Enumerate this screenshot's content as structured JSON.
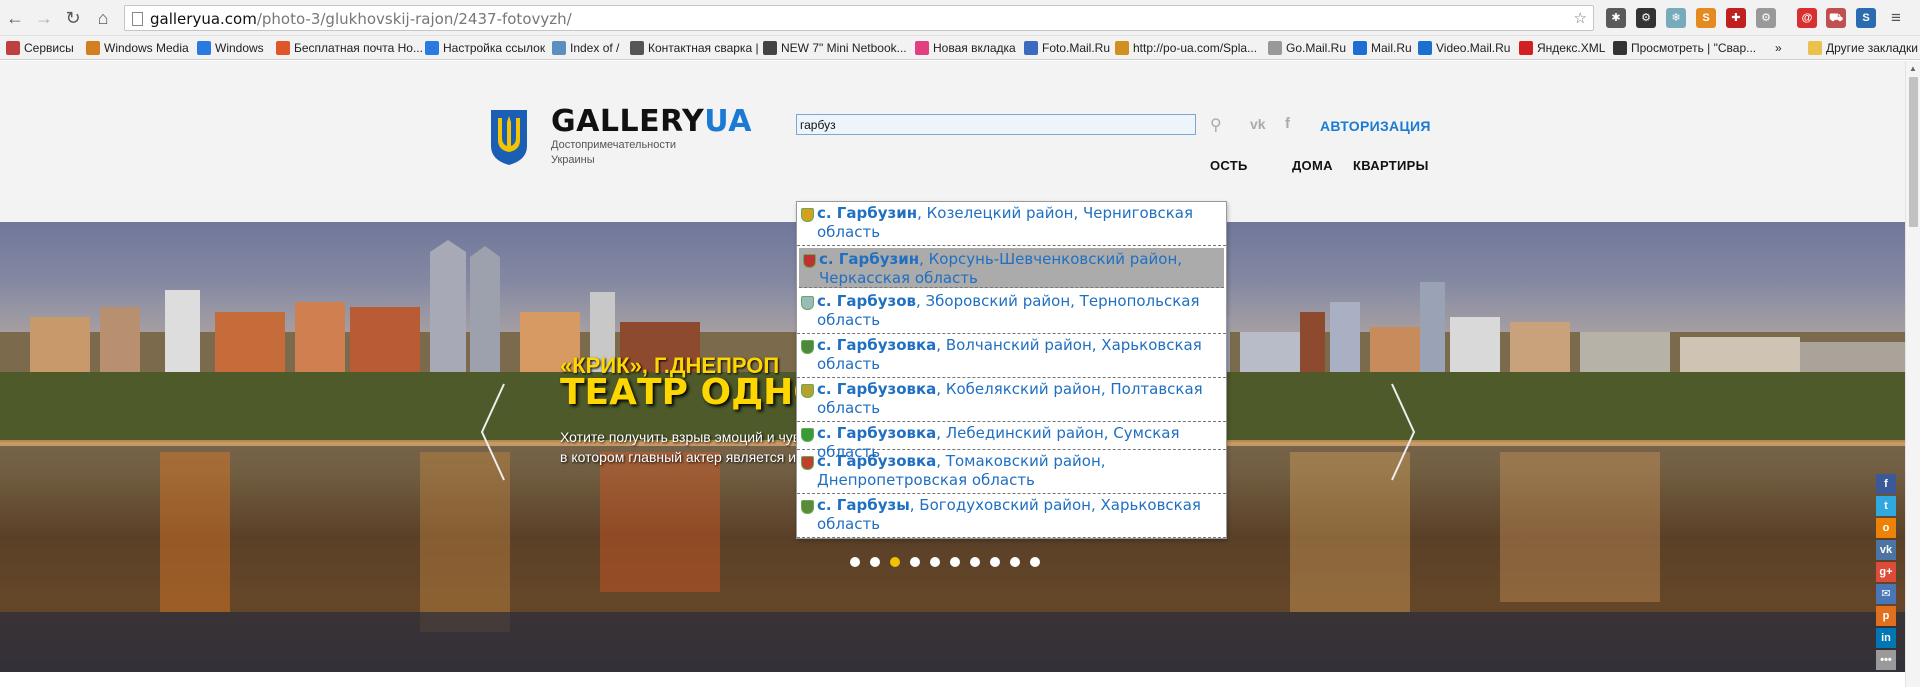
{
  "browser": {
    "url_domain": "galleryua.com",
    "url_path": "/photo-3/glukhovskij-rajon/2437-fotovyzh/",
    "bookmarks": [
      {
        "label": "Сервисы",
        "color": "#c04040"
      },
      {
        "label": "Windows Media",
        "color": "#d08020"
      },
      {
        "label": "Windows",
        "color": "#2a7ae2"
      },
      {
        "label": "Бесплатная почта Ho...",
        "color": "#e0552a"
      },
      {
        "label": "Настройка ссылок",
        "color": "#2a7ae2"
      },
      {
        "label": "Index of /",
        "color": "#5a8fc0"
      },
      {
        "label": "Контактная сварка |",
        "color": "#555555"
      },
      {
        "label": "NEW 7\" Mini Netbook...",
        "color": "#444444"
      },
      {
        "label": "Новая вкладка",
        "color": "#e04080"
      },
      {
        "label": "Foto.Mail.Ru",
        "color": "#3a6bbf"
      },
      {
        "label": "http://po-ua.com/Spla...",
        "color": "#d09020"
      },
      {
        "label": "Go.Mail.Ru",
        "color": "#999999"
      },
      {
        "label": "Mail.Ru",
        "color": "#1a6fd0"
      },
      {
        "label": "Video.Mail.Ru",
        "color": "#1a6fd0"
      },
      {
        "label": "Яндекс.XML",
        "color": "#d02020"
      },
      {
        "label": "Просмотреть | \"Свар...",
        "color": "#333333"
      }
    ],
    "bookmarks_overflow": "»",
    "other_bookmarks": "Другие закладки"
  },
  "site": {
    "brand_main": "GALLERY",
    "brand_accent": "UA",
    "tagline": "Достопримечательности Украины",
    "search_value": "гарбуз",
    "social_vk": "vk",
    "social_fb": "f",
    "auth_label": "АВТОРИЗАЦИЯ",
    "menu": [
      "ОСТЬ",
      "ДОМА",
      "КВАРТИРЫ"
    ]
  },
  "hero": {
    "subtitle": "«КРИК», Г.ДНЕПРОП",
    "title": "ТЕАТР ОДНО",
    "desc_line1": "Хотите получить взрыв эмоций и чувств? Посетите вместе с нами театр,",
    "desc_line2": "в котором главный актер является и режиссером, и сценаристом, и художником ...",
    "slide_count": 10,
    "active_slide": 3
  },
  "suggestions": [
    {
      "name": "с. Гарбузин",
      "rest": ", Козелецкий район, Черниговская",
      "line2": "область",
      "selected": false
    },
    {
      "name": "с. Гарбузин",
      "rest": ", Корсунь-Шевченковский район,",
      "line2": "Черкасская область",
      "selected": true
    },
    {
      "name": "с. Гарбузов",
      "rest": ", Зборовский район, Тернопольская",
      "line2": "область",
      "selected": false
    },
    {
      "name": "с. Гарбузовка",
      "rest": ", Волчанский район, Харьковская",
      "line2": "область",
      "selected": false
    },
    {
      "name": "с. Гарбузовка",
      "rest": ", Кобелякский район, Полтавская",
      "line2": "область",
      "selected": false
    },
    {
      "name": "с. Гарбузовка",
      "rest": ", Лебединский район, Сумская область",
      "line2": "",
      "selected": false
    },
    {
      "name": "с. Гарбузовка",
      "rest": ", Томаковский район,",
      "line2": "Днепропетровская область",
      "selected": false
    },
    {
      "name": "с. Гарбузы",
      "rest": ", Богодуховский район, Харьковская",
      "line2": "область",
      "selected": false
    }
  ],
  "share_buttons": [
    {
      "name": "facebook",
      "glyph": "f",
      "color": "#3b5998"
    },
    {
      "name": "twitter",
      "glyph": "t",
      "color": "#2fa9e0"
    },
    {
      "name": "odnoklassniki",
      "glyph": "o",
      "color": "#ee8208"
    },
    {
      "name": "vkontakte",
      "glyph": "vk",
      "color": "#4c75a3"
    },
    {
      "name": "google-plus",
      "glyph": "g+",
      "color": "#dd4b39"
    },
    {
      "name": "email",
      "glyph": "✉",
      "color": "#4a76b8"
    },
    {
      "name": "pinterest",
      "glyph": "p",
      "color": "#e07020"
    },
    {
      "name": "linkedin",
      "glyph": "in",
      "color": "#0077b5"
    },
    {
      "name": "more",
      "glyph": "•••",
      "color": "#9a9a9a"
    }
  ]
}
